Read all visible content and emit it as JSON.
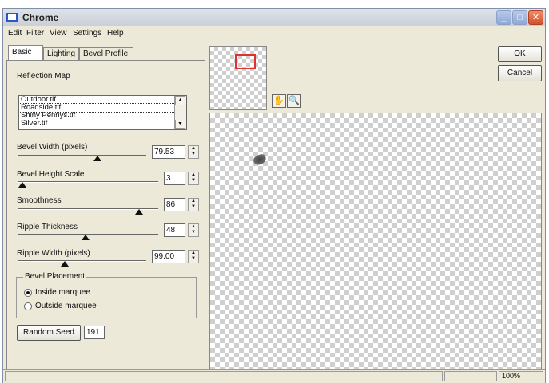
{
  "window": {
    "title": "Chrome",
    "controls": {
      "minimize": "_",
      "maximize": "□",
      "close": "✕"
    }
  },
  "menu": [
    "Edit",
    "Filter",
    "View",
    "Settings",
    "Help"
  ],
  "tabs": [
    {
      "label": "Basic",
      "active": true
    },
    {
      "label": "Lighting",
      "active": false
    },
    {
      "label": "Bevel Profile",
      "active": false
    }
  ],
  "reflection": {
    "label": "Reflection Map",
    "items": [
      "Outdoor.tif",
      "Roadside.tif",
      "Shiny Pennys.tif",
      "Silver.tif"
    ],
    "selected": "Roadside.tif"
  },
  "controls": [
    {
      "label": "Bevel Width (pixels)",
      "value": "79.53",
      "slider_fraction": 0.62
    },
    {
      "label": "Bevel Height Scale",
      "value": "3",
      "slider_fraction": 0.03
    },
    {
      "label": "Smoothness",
      "value": "86",
      "slider_fraction": 0.86
    },
    {
      "label": "Ripple Thickness",
      "value": "48",
      "slider_fraction": 0.48
    },
    {
      "label": "Ripple Width (pixels)",
      "value": "99.00",
      "slider_fraction": 0.36
    }
  ],
  "placement": {
    "title": "Bevel Placement",
    "options": [
      {
        "label": "Inside marquee",
        "checked": true
      },
      {
        "label": "Outside marquee",
        "checked": false
      }
    ]
  },
  "seed": {
    "button": "Random Seed",
    "value": "191"
  },
  "actions": {
    "ok": "OK",
    "cancel": "Cancel"
  },
  "status": {
    "zoom": "100%"
  },
  "icons": {
    "hand": "hand-icon",
    "zoom": "magnifier-icon"
  },
  "colors": {
    "viewport_box": "#e03030",
    "title_icon": "#2a57c8"
  }
}
